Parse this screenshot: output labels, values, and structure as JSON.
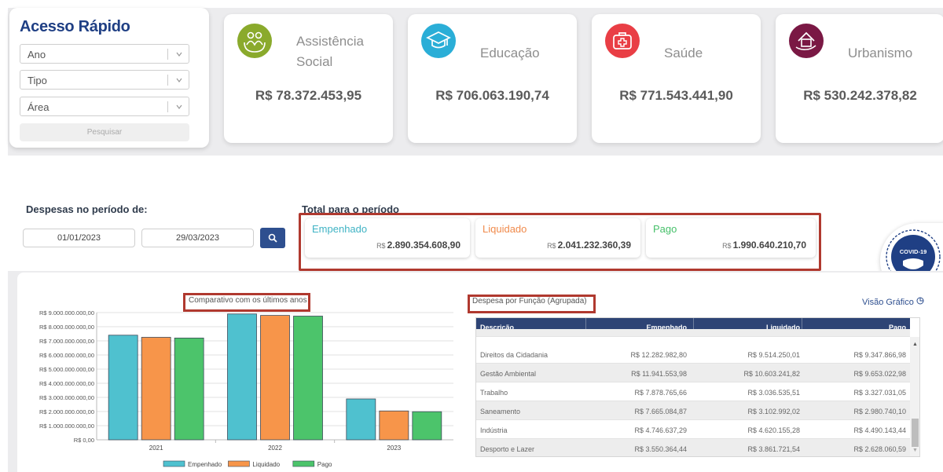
{
  "quick_access": {
    "title": "Acesso Rápido",
    "filters": [
      {
        "label": "Ano"
      },
      {
        "label": "Tipo"
      },
      {
        "label": "Área"
      }
    ],
    "search_label": "Pesquisar"
  },
  "function_cards": [
    {
      "name_line1": "Assistência",
      "name_line2": "Social",
      "value": "R$ 78.372.453,95",
      "color": "#8aaa2c",
      "icon": "family-care-icon"
    },
    {
      "name_line1": "Educação",
      "name_line2": "",
      "value": "R$ 706.063.190,74",
      "color": "#2aaed7",
      "icon": "graduation-cap-icon"
    },
    {
      "name_line1": "Saúde",
      "name_line2": "",
      "value": "R$ 771.543.441,90",
      "color": "#e93e45",
      "icon": "medical-kit-icon"
    },
    {
      "name_line1": "Urbanismo",
      "name_line2": "",
      "value": "R$ 530.242.378,82",
      "color": "#7a1844",
      "icon": "house-hand-icon"
    }
  ],
  "period": {
    "label": "Despesas no período de:",
    "start": "01/01/2023",
    "end": "29/03/2023"
  },
  "totals": {
    "label": "Total para o período",
    "items": [
      {
        "label": "Empenhado",
        "currency": "R$",
        "value": "2.890.354.608,90",
        "color": "#3fb3c4"
      },
      {
        "label": "Liquidado",
        "currency": "R$",
        "value": "2.041.232.360,39",
        "color": "#f08a4b"
      },
      {
        "label": "Pago",
        "currency": "R$",
        "value": "1.990.640.210,70",
        "color": "#46c06a"
      }
    ]
  },
  "covid_badge": "COVID-19",
  "chart_title": "Comparativo com os últimos anos",
  "chart_data": {
    "type": "bar",
    "categories": [
      "2021",
      "2022",
      "2023"
    ],
    "series": [
      {
        "name": "Empenhado",
        "values": [
          7400000000,
          8900000000,
          2890354608.9
        ],
        "color": "#4fc1cf"
      },
      {
        "name": "Liquidado",
        "values": [
          7250000000,
          8800000000,
          2041232360.39
        ],
        "color": "#f7954a"
      },
      {
        "name": "Pago",
        "values": [
          7200000000,
          8750000000,
          1990640210.7
        ],
        "color": "#4cc46b"
      }
    ],
    "ylim": [
      0,
      9000000000
    ],
    "yticks": [
      "R$ 0,00",
      "R$ 1.000.000.000,00",
      "R$ 2.000.000.000,00",
      "R$ 3.000.000.000,00",
      "R$ 4.000.000.000,00",
      "R$ 5.000.000.000,00",
      "R$ 6.000.000.000,00",
      "R$ 7.000.000.000,00",
      "R$ 8.000.000.000,00",
      "R$ 9.000.000.000,00"
    ],
    "legend_position": "bottom",
    "grid": true
  },
  "table": {
    "title": "Despesa por Função (Agrupada)",
    "view_link": "Visão Gráfico",
    "headers": [
      "Descrição",
      "Empenhado",
      "Liquidado",
      "Pago"
    ],
    "rows": [
      [
        "Direitos da Cidadania",
        "R$ 12.282.982,80",
        "R$ 9.514.250,01",
        "R$ 9.347.866,98"
      ],
      [
        "Gestão Ambiental",
        "R$ 11.941.553,98",
        "R$ 10.603.241,82",
        "R$ 9.653.022,98"
      ],
      [
        "Trabalho",
        "R$ 7.878.765,66",
        "R$ 3.036.535,51",
        "R$ 3.327.031,05"
      ],
      [
        "Saneamento",
        "R$ 7.665.084,87",
        "R$ 3.102.992,02",
        "R$ 2.980.740,10"
      ],
      [
        "Indústria",
        "R$ 4.746.637,29",
        "R$ 4.620.155,28",
        "R$ 4.490.143,44"
      ],
      [
        "Desporto e Lazer",
        "R$ 3.550.364,44",
        "R$ 3.861.721,54",
        "R$ 2.628.060,59"
      ]
    ]
  }
}
